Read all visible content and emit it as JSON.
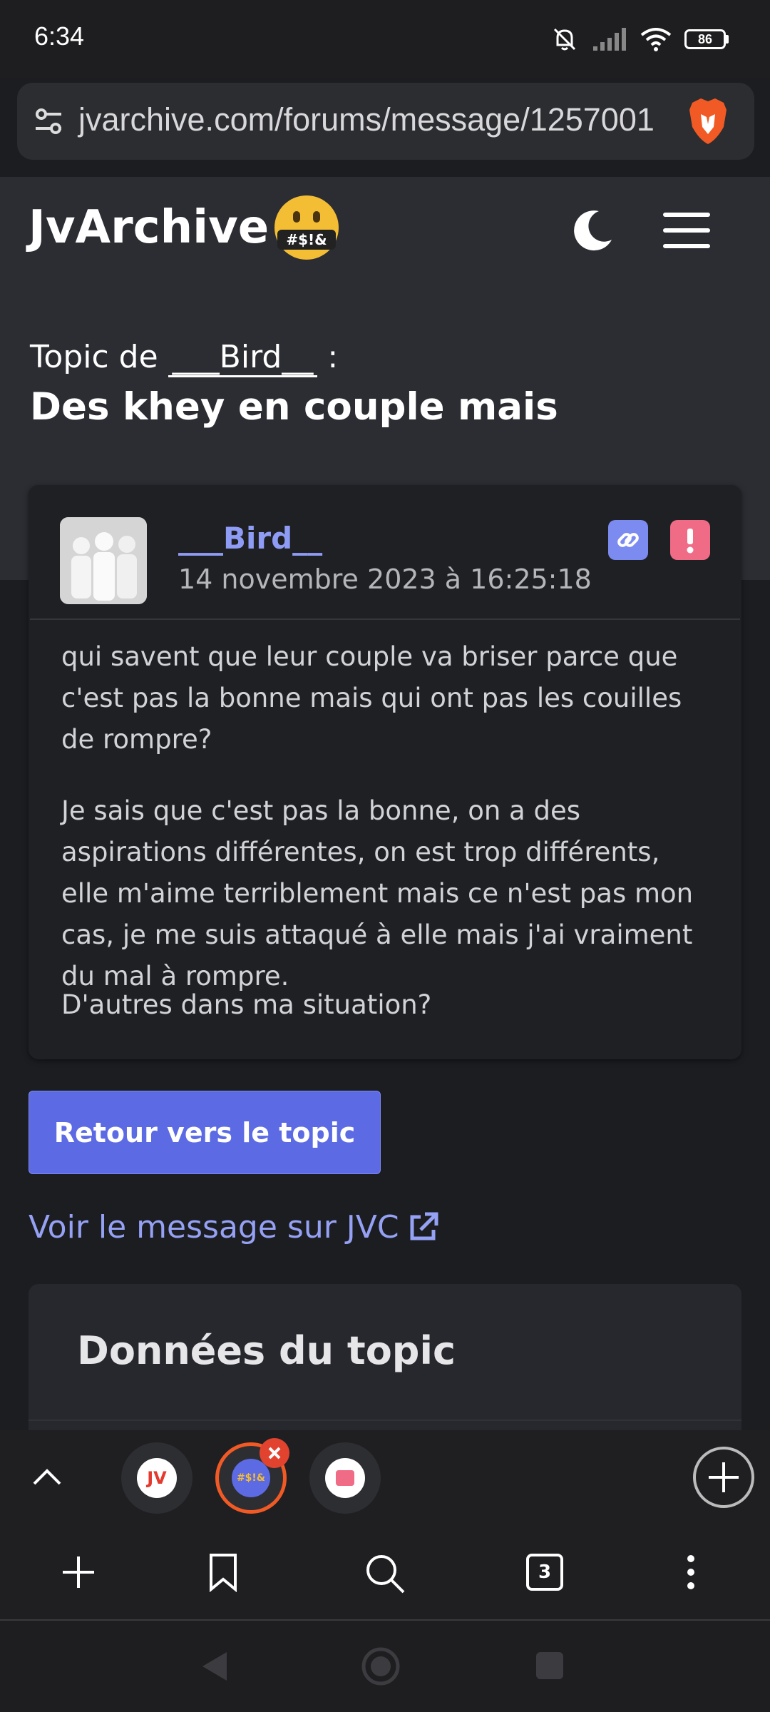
{
  "status_bar": {
    "time": "6:34",
    "battery": "86"
  },
  "browser": {
    "url": "jvarchive.com/forums/message/1257001",
    "tab_count": "3"
  },
  "site": {
    "title": "JvArchive",
    "emoji_text": "#$!&"
  },
  "topic": {
    "prefix": "Topic de",
    "author": "___Bird__",
    "suffix": ":",
    "title": "Des khey en couple mais"
  },
  "message": {
    "author": "___Bird__",
    "date": "14 novembre 2023 à 16:25:18",
    "paragraphs": [
      "qui savent que leur couple va briser parce que c'est pas la bonne mais qui ont pas les couilles de rompre?",
      "Je sais que c'est pas la bonne, on a des aspirations différentes, on est trop différents, elle m'aime terriblement mais ce n'est pas mon cas, je me suis attaqué à elle mais j'ai vraiment du mal à rompre.",
      "D'autres dans ma situation?"
    ]
  },
  "actions": {
    "back_label": "Retour vers le topic",
    "jvc_link_label": "Voir le message sur JVC"
  },
  "topic_data": {
    "title": "Données du topic"
  },
  "tabs": {
    "tab1_label": "JV",
    "tab2_label": "#$!&"
  },
  "colors": {
    "accent": "#5c6ae4",
    "link": "#95a1f4",
    "report": "#f06c86",
    "brave": "#f15a24"
  }
}
